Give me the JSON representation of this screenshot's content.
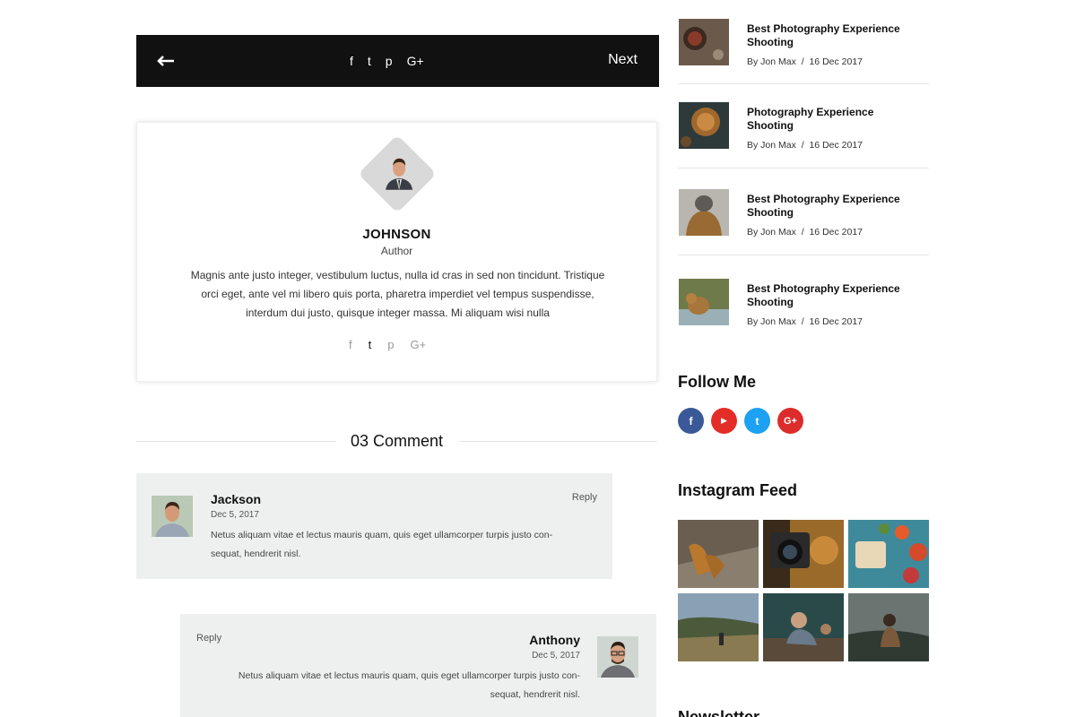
{
  "post_nav": {
    "back_icon": "arrow-left-icon",
    "share_icons": [
      "f",
      "t",
      "p",
      "G+"
    ],
    "next_label": "Next"
  },
  "author": {
    "name": "JOHNSON",
    "role": "Author",
    "bio": "Magnis ante justo integer, vestibulum luctus, nulla id cras in sed non tincidunt. Tristique orci eget, ante vel mi libero quis porta, pharetra imperdiet vel tempus suspendisse, interdum dui justo, quisque integer massa. Mi aliquam wisi nulla",
    "share_icons": [
      "f",
      "t",
      "p",
      "G+"
    ]
  },
  "comments": {
    "heading": "03 Comment",
    "items": [
      {
        "name": "Jackson",
        "date": "Dec 5, 2017",
        "text": "Netus aliquam vitae et lectus mauris quam, quis eget ullamcorper turpis justo con-sequat, hendrerit nisl.",
        "reply_label": "Reply"
      },
      {
        "name": "Anthony",
        "date": "Dec 5, 2017",
        "text": "Netus aliquam vitae et lectus mauris quam, quis eget ullamcorper turpis justo con-sequat, hendrerit nisl.",
        "reply_label": "Reply"
      }
    ]
  },
  "sidebar": {
    "recent_posts": [
      {
        "title": "Best Photography Experience Shooting",
        "author": "By Jon Max",
        "date": "16 Dec 2017"
      },
      {
        "title": "Photography Experience Shooting",
        "author": "By Jon Max",
        "date": "16 Dec 2017"
      },
      {
        "title": "Best Photography Experience Shooting",
        "author": "By Jon Max",
        "date": "16 Dec 2017"
      },
      {
        "title": "Best Photography Experience Shooting",
        "author": "By Jon Max",
        "date": "16 Dec 2017"
      }
    ],
    "meta_separator": "/",
    "follow_heading": "Follow Me",
    "follow_icons": [
      {
        "glyph": "f",
        "color": "#3b5998"
      },
      {
        "glyph": "▶",
        "color": "#e52d27"
      },
      {
        "glyph": "t",
        "color": "#1da1f2"
      },
      {
        "glyph": "G+",
        "color": "#dd2c2c"
      }
    ],
    "instagram_heading": "Instagram Feed",
    "newsletter_heading": "Newsletter"
  }
}
